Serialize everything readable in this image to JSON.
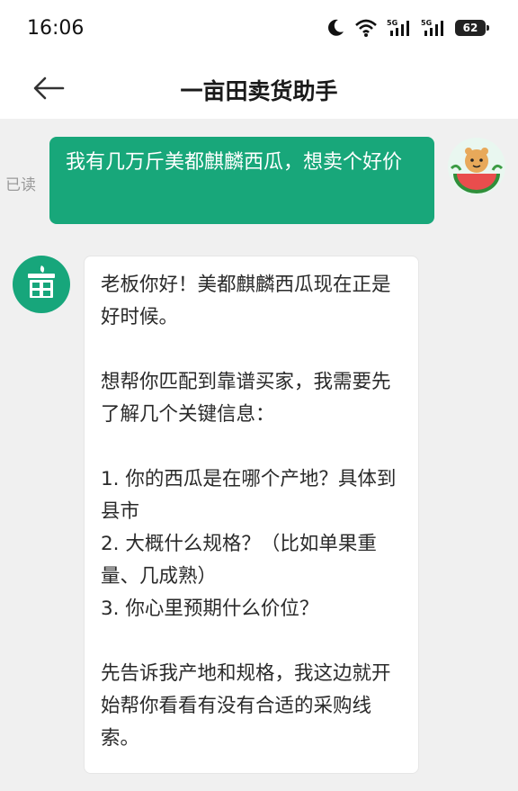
{
  "status_bar": {
    "time": "16:06",
    "icons": [
      "moon-icon",
      "wifi-icon",
      "signal-5g-icon",
      "signal-5g-icon",
      "battery-icon"
    ],
    "battery_level": "62"
  },
  "header": {
    "title": "一亩田卖货助手",
    "back_icon": "arrow-left-icon"
  },
  "chat": {
    "user_message": {
      "read_status": "已读",
      "text": "我有几万斤美都麒麟西瓜，想卖个好价",
      "avatar": "watermelon-avatar"
    },
    "bot_message": {
      "avatar": "yimutian-logo",
      "paragraphs": [
        "老板你好！美都麒麟西瓜现在正是好时候。",
        "想帮你匹配到靠谱买家，我需要先了解几个关键信息：",
        "1. 你的西瓜是在哪个产地？具体到县市",
        "2. 大概什么规格？（比如单果重量、几成熟）",
        "3. 你心里预期什么价位？",
        "先告诉我产地和规格，我这边就开始帮你看看有没有合适的采购线索。"
      ]
    }
  },
  "colors": {
    "accent": "#18a77a",
    "background": "#f0f0f0"
  }
}
